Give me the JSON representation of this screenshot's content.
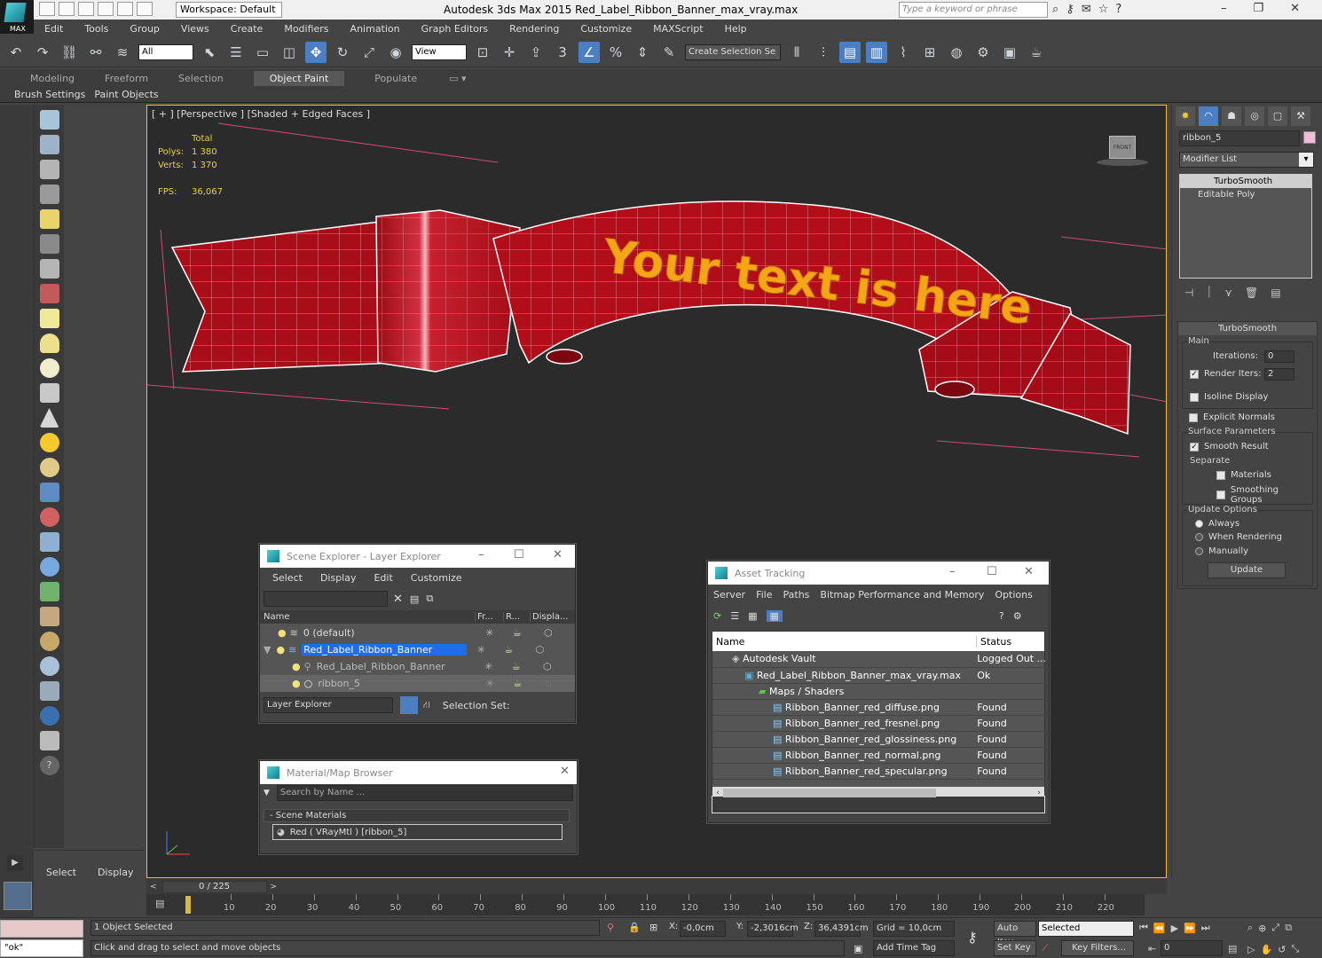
{
  "app": {
    "workspace": "Workspace: Default",
    "window_title": "Autodesk 3ds Max  2015     Red_Label_Ribbon_Banner_max_vray.max",
    "keyword_placeholder": "Type a keyword or phrase",
    "logo_text": "MAX"
  },
  "menu": [
    "Edit",
    "Tools",
    "Group",
    "Views",
    "Create",
    "Modifiers",
    "Animation",
    "Graph Editors",
    "Rendering",
    "Customize",
    "MAXScript",
    "Help"
  ],
  "toolbar": {
    "selection_filter": "All",
    "ref_coord": "View",
    "snap_label": "3",
    "selection_set_placeholder": "Create Selection Se",
    "angle_snap_label": "%"
  },
  "ribbon": {
    "tabs": [
      "Modeling",
      "Freeform",
      "Selection",
      "Object Paint",
      "Populate"
    ],
    "active_tab": "Object Paint",
    "sub": [
      "Brush Settings",
      "Paint Objects"
    ]
  },
  "viewport": {
    "label": "[ + ] [Perspective ] [Shaded + Edged Faces ]",
    "stats": {
      "total_label": "Total",
      "polys_label": "Polys:",
      "polys": "1 380",
      "verts_label": "Verts:",
      "verts": "1 370",
      "fps_label": "FPS:",
      "fps": "36,067"
    },
    "banner_text": "Your text is here",
    "viewcube_label": "FRONT",
    "accent_color": "#f0c12f"
  },
  "command_panel": {
    "object_name": "ribbon_5",
    "modifier_list": "Modifier List",
    "stack": [
      "TurboSmooth",
      "Editable Poly"
    ],
    "rollout_title": "TurboSmooth",
    "main_label": "Main",
    "iterations_label": "Iterations:",
    "iterations": "0",
    "render_iters_label": "Render Iters:",
    "render_iters": "2",
    "isoline": "Isoline Display",
    "explicit_normals": "Explicit Normals",
    "surface_params": "Surface Parameters",
    "smooth_result": "Smooth Result",
    "separate": "Separate",
    "materials": "Materials",
    "smoothing_groups": "Smoothing Groups",
    "update_options": "Update Options",
    "always": "Always",
    "when_rendering": "When Rendering",
    "manually": "Manually",
    "update_btn": "Update"
  },
  "left_panel": {
    "tabs": [
      "Select",
      "Display"
    ]
  },
  "scene_explorer": {
    "title": "Scene Explorer - Layer Explorer",
    "menu": [
      "Select",
      "Display",
      "Edit",
      "Customize"
    ],
    "columns": [
      "Name",
      "Fr...",
      "R...",
      "Displa..."
    ],
    "rows": [
      "0 (default)",
      "Red_Label_Ribbon_Banner",
      "Red_Label_Ribbon_Banner",
      "ribbon_5"
    ],
    "selected_row": "Red_Label_Ribbon_Banner",
    "footer_mode": "Layer Explorer",
    "selection_set_label": "Selection Set:"
  },
  "material_browser": {
    "title": "Material/Map Browser",
    "search_placeholder": "Search by Name ...",
    "group": "- Scene Materials",
    "item": "Red  ( VRayMtl ) [ribbon_5]"
  },
  "asset_tracking": {
    "title": "Asset Tracking",
    "menu": [
      "Server",
      "File",
      "Paths",
      "Bitmap Performance and Memory",
      "Options"
    ],
    "columns": [
      "Name",
      "Status"
    ],
    "rows": [
      {
        "name": "Autodesk Vault",
        "status": "Logged Out ..."
      },
      {
        "name": "Red_Label_Ribbon_Banner_max_vray.max",
        "status": "Ok"
      },
      {
        "name": "Maps / Shaders",
        "status": ""
      },
      {
        "name": "Ribbon_Banner_red_diffuse.png",
        "status": "Found"
      },
      {
        "name": "Ribbon_Banner_red_fresnel.png",
        "status": "Found"
      },
      {
        "name": "Ribbon_Banner_red_glossiness.png",
        "status": "Found"
      },
      {
        "name": "Ribbon_Banner_red_normal.png",
        "status": "Found"
      },
      {
        "name": "Ribbon_Banner_red_specular.png",
        "status": "Found"
      }
    ]
  },
  "timeline": {
    "frame_counter": "0 / 225",
    "ticks": [
      "10",
      "20",
      "30",
      "40",
      "50",
      "60",
      "70",
      "80",
      "90",
      "100",
      "110",
      "120",
      "130",
      "140",
      "150",
      "160",
      "170",
      "180",
      "190",
      "200",
      "210",
      "220"
    ]
  },
  "status": {
    "listener": "\"ok\"",
    "selected_count": "1 Object Selected",
    "prompt": "Click and drag to select and move objects",
    "x_label": "X:",
    "x": "-0,0cm",
    "y_label": "Y:",
    "y": "-2,3016cm",
    "z_label": "Z:",
    "z": "36,4391cm",
    "grid": "Grid = 10,0cm",
    "auto_key": "Auto Key",
    "set_key": "Set Key",
    "key_mode": "Selected",
    "key_filters": "Key Filters...",
    "add_time_tag": "Add Time Tag",
    "current_frame": "0"
  }
}
